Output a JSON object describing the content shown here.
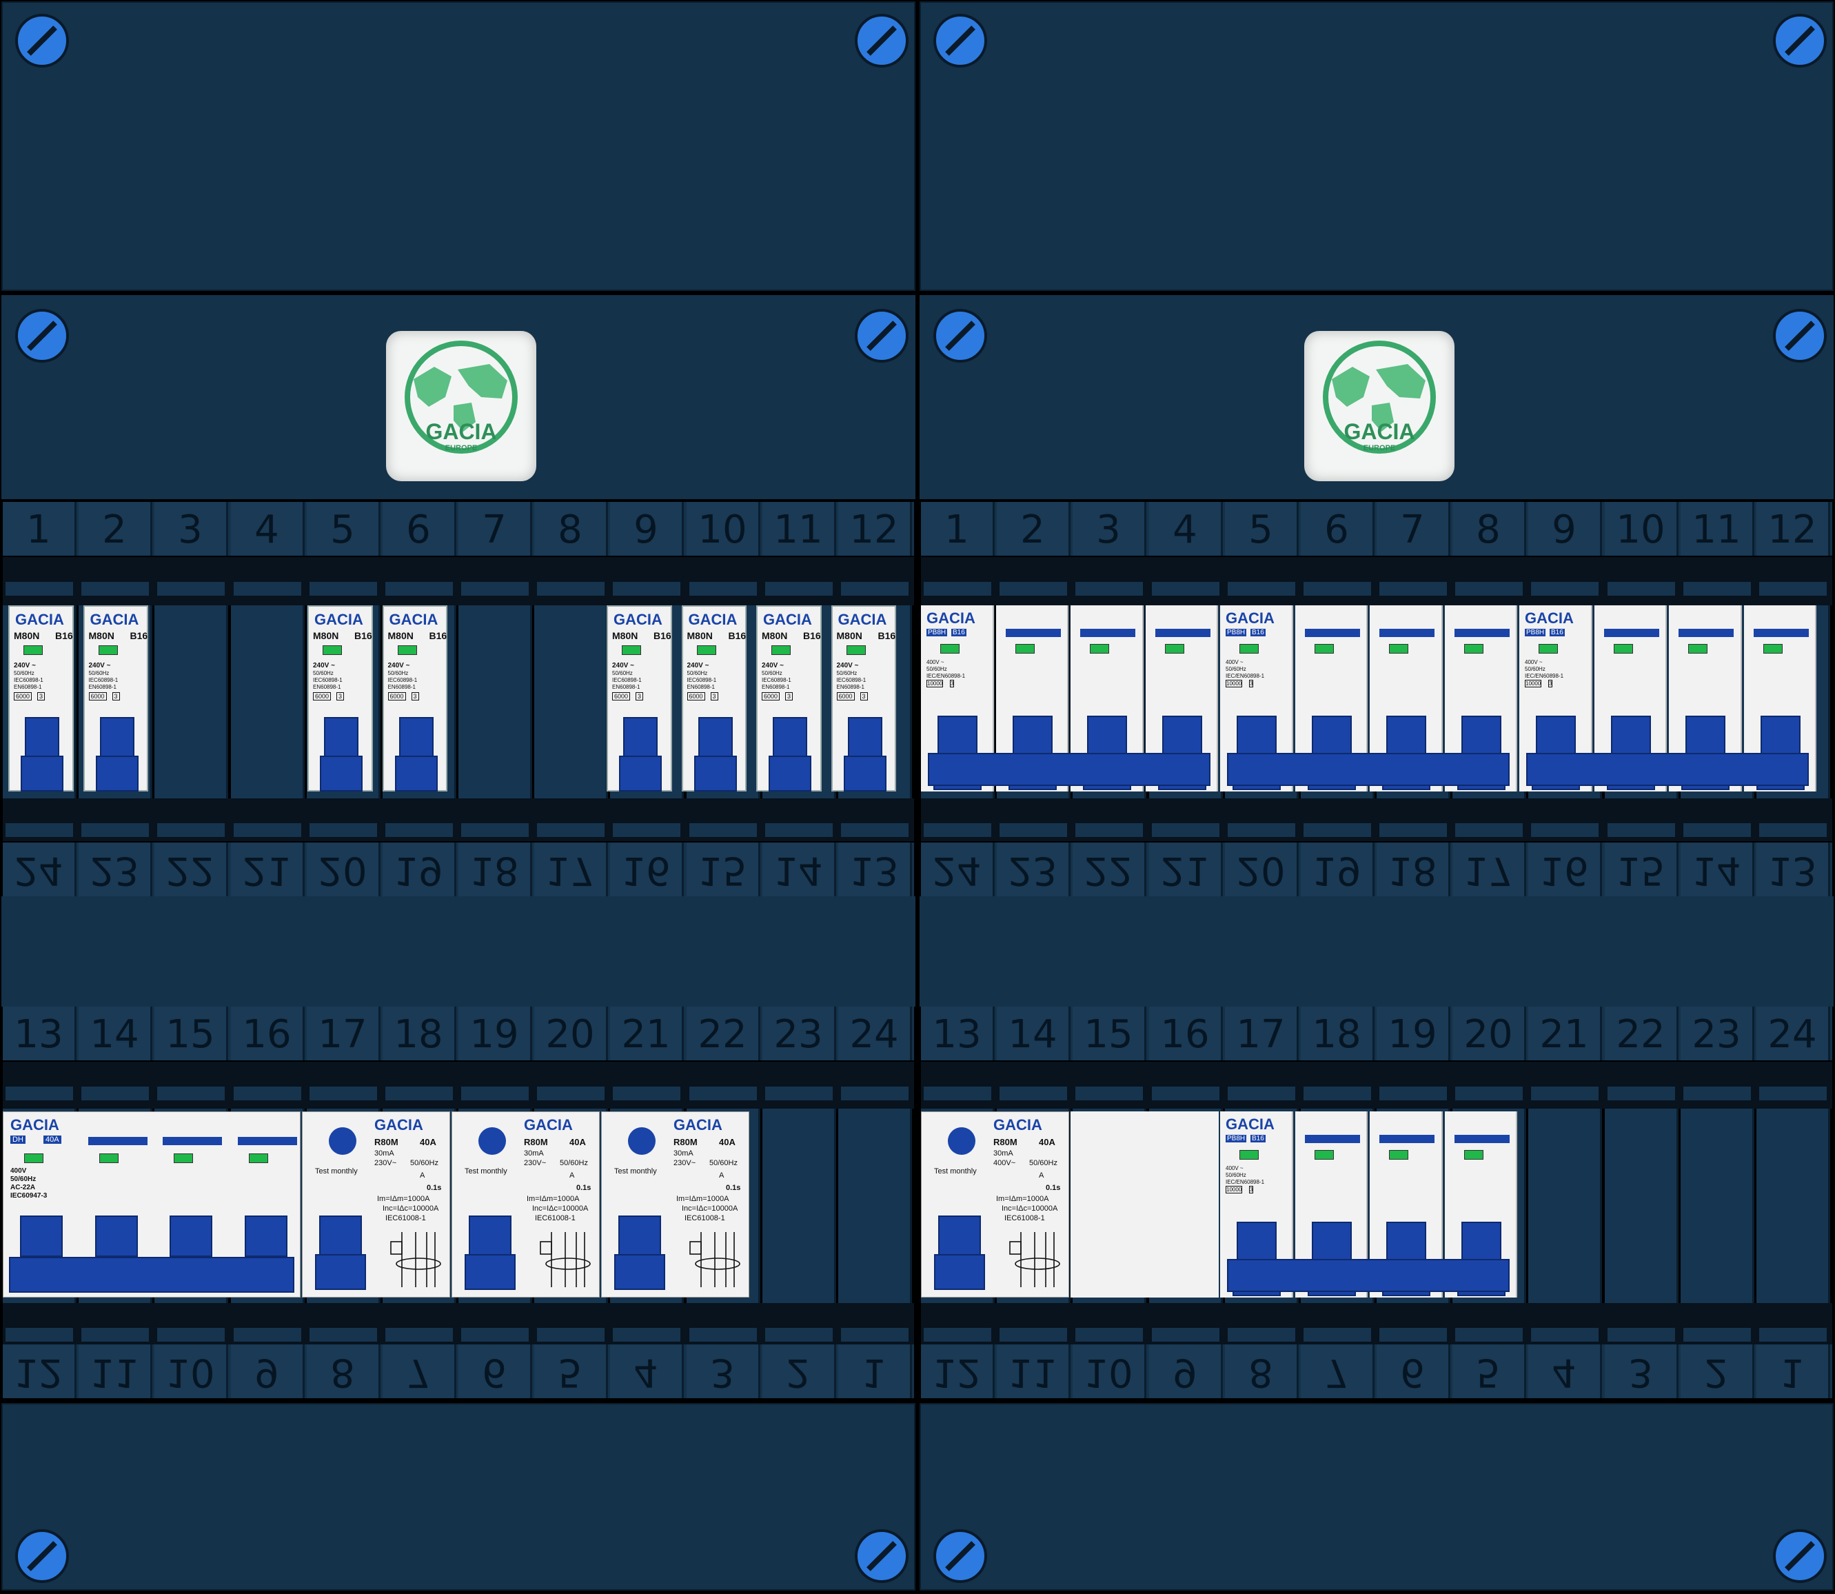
{
  "brand": {
    "badge_name": "GACIA",
    "badge_sub": "EUROPE",
    "device_brand": "GACIA"
  },
  "rail_numbers": {
    "top": [
      "1",
      "2",
      "3",
      "4",
      "5",
      "6",
      "7",
      "8",
      "9",
      "10",
      "11",
      "12"
    ],
    "top_mirror": [
      "24",
      "23",
      "22",
      "21",
      "20",
      "19",
      "18",
      "17",
      "16",
      "15",
      "14",
      "13"
    ],
    "bottom": [
      "13",
      "14",
      "15",
      "16",
      "17",
      "18",
      "19",
      "20",
      "21",
      "22",
      "23",
      "24"
    ],
    "bottom_mirror": [
      "12",
      "11",
      "10",
      "9",
      "8",
      "7",
      "6",
      "5",
      "4",
      "3",
      "2",
      "1"
    ]
  },
  "mcb": {
    "model": "M80N",
    "rating": "B16",
    "voltage": "240V ~",
    "freq": "50/60Hz",
    "std1": "IEC60898-1",
    "std2": "EN60898-1",
    "capacity": "6000",
    "cls": "3"
  },
  "rcbo": {
    "model": "PB8H",
    "rating": "B16",
    "voltage": "400V ~",
    "freq": "50/60Hz",
    "std": "IEC/EN60898-1",
    "capacity": "10000",
    "cls": "3"
  },
  "main_switch": {
    "model": "DH",
    "rating": "40A",
    "voltage": "400V",
    "freq": "50/60Hz",
    "cat": "AC-22A",
    "std": "IEC60947-3"
  },
  "rcd_2p": {
    "test": "Test monthly",
    "model": "R80M",
    "rating": "40A",
    "sens": "30mA",
    "voltage": "230V~",
    "freq": "50/60Hz",
    "type": "A",
    "time": "0.1s",
    "im": "Im=IΔm=1000A",
    "inc": "Inc=IΔc=10000A",
    "std": "IEC61008-1"
  },
  "rcd_4p": {
    "voltage": "400V~"
  },
  "colors": {
    "panel": "#14324a",
    "panel_line": "#0a1e2f",
    "accent": "#1a44a8",
    "indicator": "#20b84a",
    "screw": "#2d7be0",
    "device": "#f2f2f2"
  }
}
